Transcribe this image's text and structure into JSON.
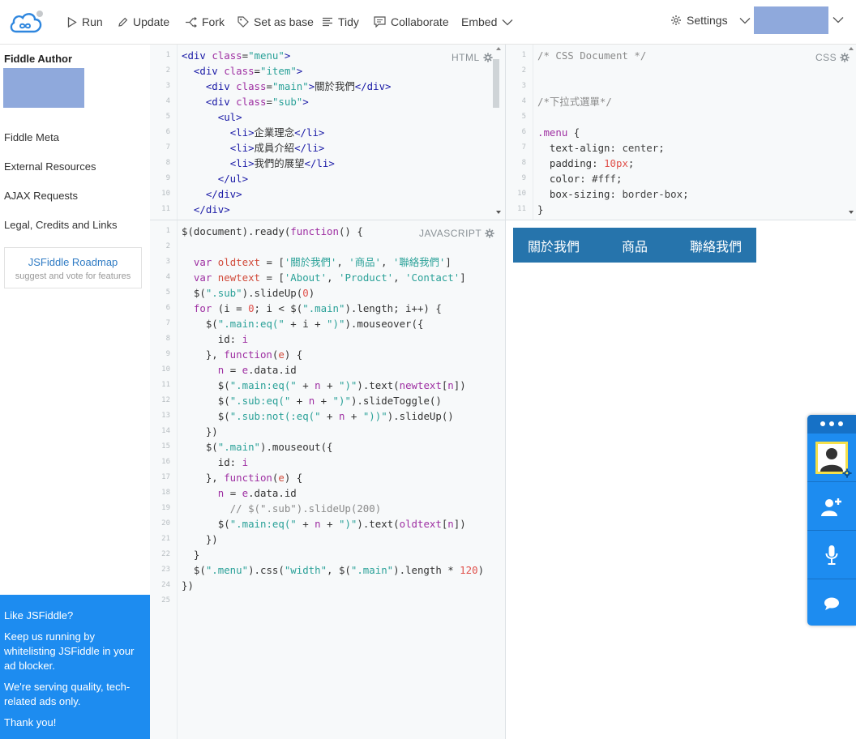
{
  "toolbar": {
    "run": "Run",
    "update": "Update",
    "fork": "Fork",
    "set_as_base": "Set as base",
    "tidy": "Tidy",
    "collaborate": "Collaborate",
    "embed": "Embed",
    "settings": "Settings"
  },
  "sidebar": {
    "author_title": "Fiddle Author",
    "links": [
      "Fiddle Meta",
      "External Resources",
      "AJAX Requests",
      "Legal, Credits and Links"
    ],
    "roadmap_title": "JSFiddle Roadmap",
    "roadmap_sub": "suggest and vote for features",
    "ad": {
      "heading": "Like JSFiddle?",
      "p1": "Keep us running by whitelisting JSFiddle in your ad blocker.",
      "p2": "We're serving quality, tech-related ads only.",
      "p3": "Thank you!"
    }
  },
  "panels": {
    "html_label": "HTML",
    "css_label": "CSS",
    "js_label": "JAVASCRIPT"
  },
  "result": {
    "menu_items": [
      "關於我們",
      "商品",
      "聯絡我們"
    ]
  },
  "colors": {
    "accent": "#1d8cf0",
    "menu_bg": "#2674ac"
  }
}
